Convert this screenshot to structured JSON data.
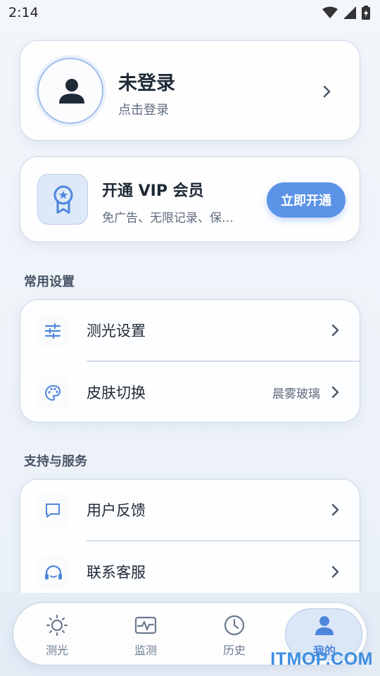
{
  "status_bar": {
    "time": "2:14"
  },
  "profile": {
    "name": "未登录",
    "subtitle": "点击登录"
  },
  "vip": {
    "title": "开通 VIP 会员",
    "description": "免广告、无限记录、保…",
    "button_label": "立即开通"
  },
  "sections": {
    "common": {
      "title": "常用设置",
      "items": [
        {
          "label": "测光设置",
          "icon": "sliders-icon",
          "value": ""
        },
        {
          "label": "皮肤切换",
          "icon": "palette-icon",
          "value": "晨雾玻璃"
        }
      ]
    },
    "support": {
      "title": "支持与服务",
      "items": [
        {
          "label": "用户反馈",
          "icon": "message-icon"
        },
        {
          "label": "联系客服",
          "icon": "headset-icon"
        }
      ]
    }
  },
  "bottom_nav": {
    "items": [
      {
        "label": "测光",
        "icon": "sun-icon",
        "active": false
      },
      {
        "label": "监测",
        "icon": "pulse-icon",
        "active": false
      },
      {
        "label": "历史",
        "icon": "clock-icon",
        "active": false
      },
      {
        "label": "我的",
        "icon": "user-icon",
        "active": true
      }
    ]
  },
  "watermark": "ITMOP.COM",
  "colors": {
    "accent": "#5b93e6",
    "active_tab": "#4e86dc",
    "text_primary": "#1f2a37",
    "text_secondary": "#5d6b7c"
  }
}
